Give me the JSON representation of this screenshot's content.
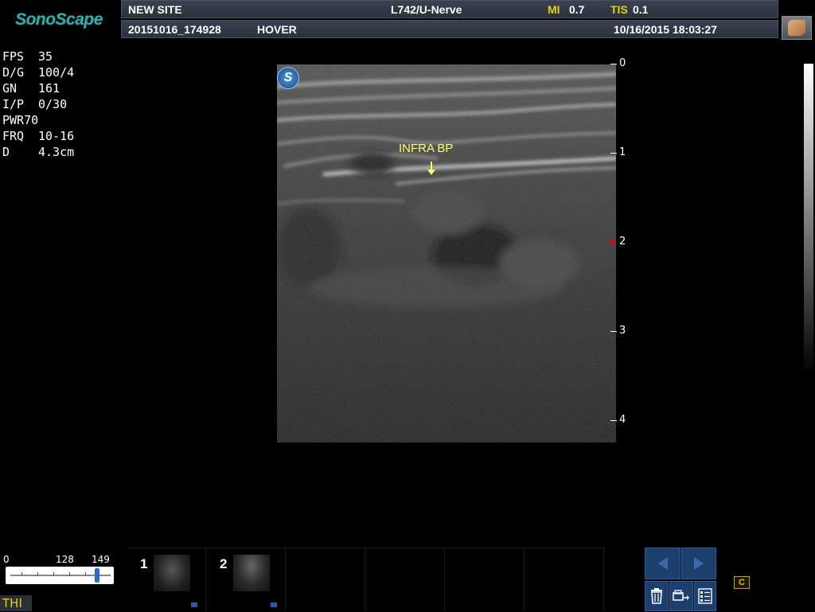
{
  "header": {
    "logo": "SonoScape",
    "site_name": "NEW SITE",
    "probe_preset": "L742/U-Nerve",
    "mi_label": "MI",
    "mi_value": "0.7",
    "tis_label": "TIS",
    "tis_value": "0.1",
    "exam_id": "20151016_174928",
    "mode": "HOVER",
    "datetime": "10/16/2015 18:03:27"
  },
  "params": [
    {
      "label": "FPS",
      "value": "35"
    },
    {
      "label": "D/G",
      "value": "100/4"
    },
    {
      "label": "GN",
      "value": "161"
    },
    {
      "label": "I/P",
      "value": "0/30"
    },
    {
      "label": "PWR",
      "value": "70"
    },
    {
      "label": "FRQ",
      "value": "10-16"
    },
    {
      "label": "D",
      "value": "4.3cm"
    }
  ],
  "image": {
    "annotation": "INFRA BP",
    "probe_marker": "S"
  },
  "depth_scale": [
    "0",
    "1",
    "2",
    "3",
    "4"
  ],
  "slider": {
    "min": "0",
    "mid": "128",
    "max": "149",
    "value": 149
  },
  "thi_label": "THI",
  "thumbnails": [
    {
      "number": "1"
    },
    {
      "number": "2"
    }
  ],
  "colors": {
    "accent_yellow": "#e6d400",
    "logo_teal": "#2ab0b0",
    "button_blue": "#1c3f6e",
    "header_bg": "#333a47"
  },
  "controls": {
    "prev_icon": "arrow-left-icon",
    "next_icon": "arrow-right-icon",
    "delete_icon": "trash-icon",
    "export_icon": "export-icon",
    "report_icon": "checklist-icon",
    "cine_icon": "cine-icon",
    "cine_label": "C"
  }
}
